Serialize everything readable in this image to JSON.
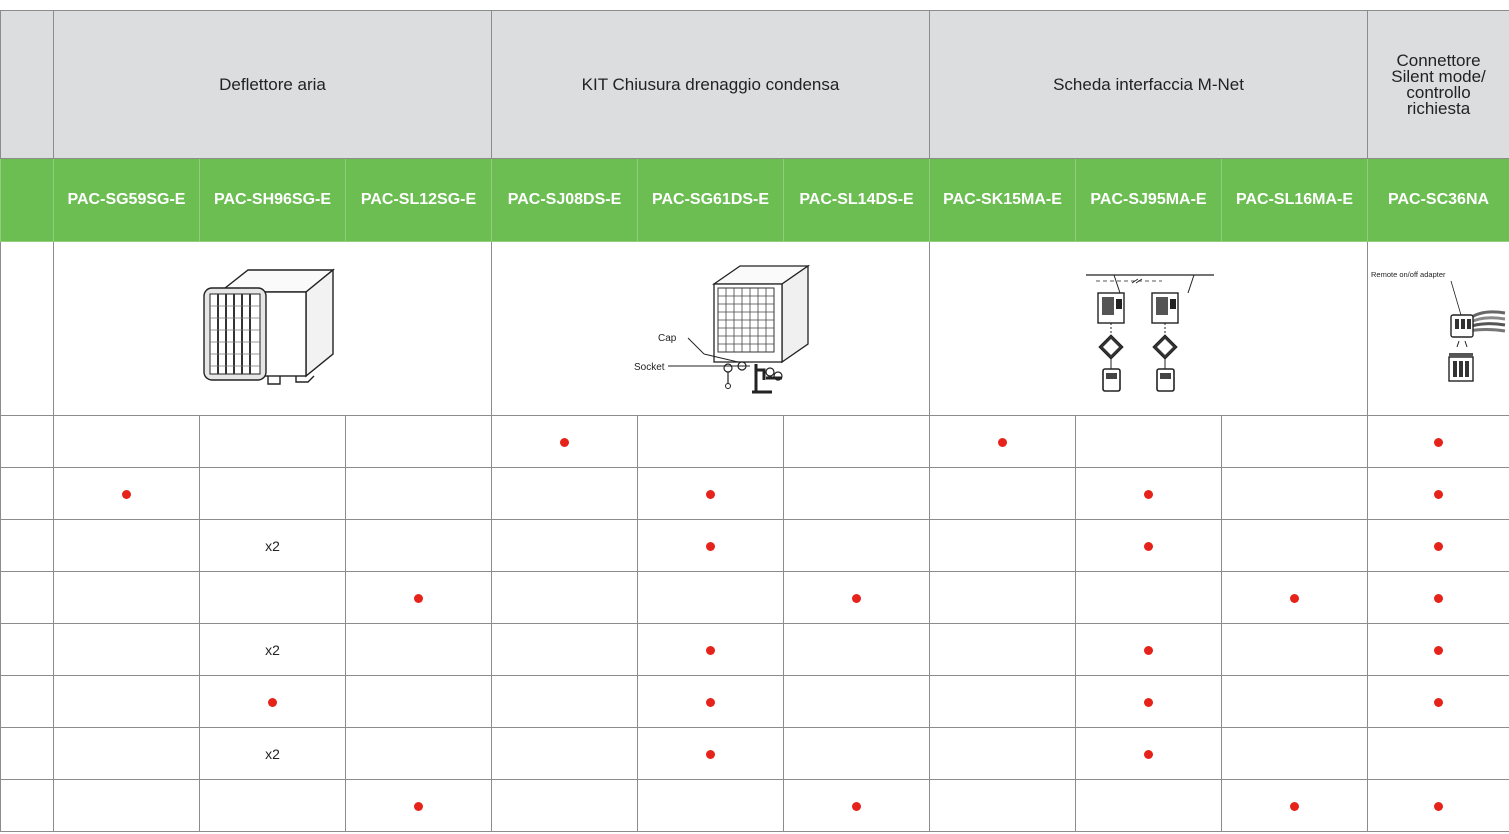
{
  "groups": [
    {
      "title": "Deflettore aria"
    },
    {
      "title": "KIT Chiusura drenaggio condensa"
    },
    {
      "title": "Scheda interfaccia M-Net"
    },
    {
      "title": "Connettore Silent mode/ controllo richiesta"
    }
  ],
  "codes": [
    "PAC-SG59SG-E",
    "PAC-SH96SG-E",
    "PAC-SL12SG-E",
    "PAC-SJ08DS-E",
    "PAC-SG61DS-E",
    "PAC-SL14DS-E",
    "PAC-SK15MA-E",
    "PAC-SJ95MA-E",
    "PAC-SL16MA-E",
    "PAC-SC36NA"
  ],
  "illustrations": {
    "drain_cap_label": "Cap",
    "drain_socket_label": "Socket",
    "adapter_label": "Remote on/off adapter",
    "icons": [
      "outdoor-unit-with-air-outlet-guide",
      "drain-socket-outdoor-unit",
      "m-net-interface-board-diagram",
      "remote-on-off-adapter-connector"
    ]
  },
  "rows": [
    [
      "",
      "",
      "",
      "dot",
      "",
      "",
      "dot",
      "",
      "",
      "dot"
    ],
    [
      "dot",
      "",
      "",
      "",
      "dot",
      "",
      "",
      "dot",
      "",
      "dot"
    ],
    [
      "",
      "x2",
      "",
      "",
      "dot",
      "",
      "",
      "dot",
      "",
      "dot"
    ],
    [
      "",
      "",
      "dot",
      "",
      "",
      "dot",
      "",
      "",
      "dot",
      "dot"
    ],
    [
      "",
      "x2",
      "",
      "",
      "dot",
      "",
      "",
      "dot",
      "",
      "dot"
    ],
    [
      "",
      "dot",
      "",
      "",
      "dot",
      "",
      "",
      "dot",
      "",
      "dot"
    ],
    [
      "",
      "x2",
      "",
      "",
      "dot",
      "",
      "",
      "dot",
      "",
      ""
    ],
    [
      "",
      "",
      "dot",
      "",
      "",
      "dot",
      "",
      "",
      "dot",
      "dot"
    ]
  ],
  "colors": {
    "header_bg": "#dcdddf",
    "code_bg": "#6cbd52",
    "dot": "#e5231b",
    "border": "#8c8c8c"
  }
}
